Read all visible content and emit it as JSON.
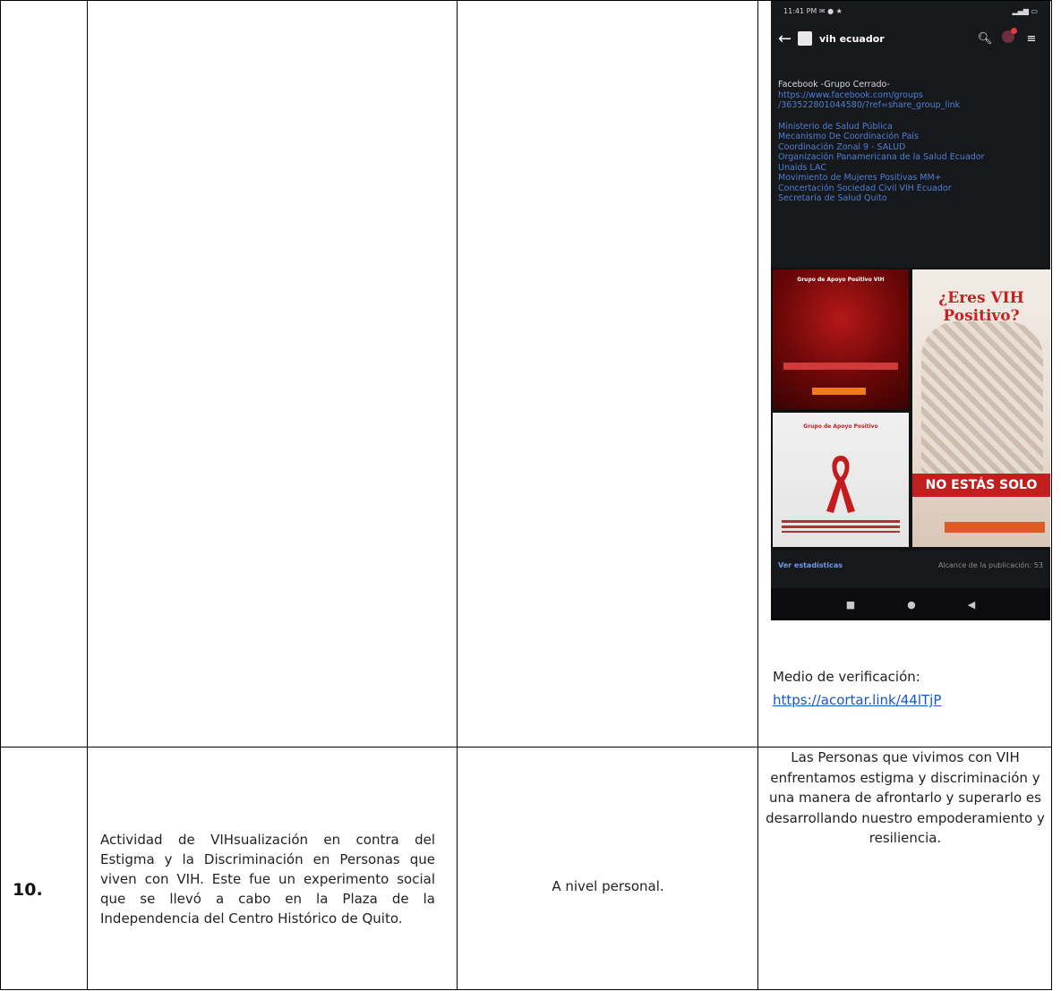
{
  "phone": {
    "status_time": "11:41 PM",
    "status_icons": "✉ ● ★",
    "status_right": "▂▄▆ ▭",
    "app_title": "vih ecuador",
    "post_heading": "Facebook -Grupo Cerrado-",
    "post_link_1": "https://www.facebook.com/groups",
    "post_link_2": "/363522801044580/?ref=share_group_link",
    "tags": [
      "Ministerio de Salud Pública",
      "Mecanismo De Coordinación País",
      "Coordinación Zonal 9 - SALUD",
      "Organización Panamericana de la Salud Ecuador",
      "Unaids LAC",
      "Movimiento de Mujeres Positivas MM+",
      "Concertación Sociedad Civil VIH Ecuador",
      "Secretaría de Salud Quito"
    ],
    "tile1_caption": "Grupo de Apoyo Positivo VIH",
    "tile2_caption": "¿Eres VIH Positivo?",
    "tile2_banner": "NO ESTÁS SOLO",
    "tile3_caption": "Grupo de Apoyo Positivo",
    "stats_link": "Ver estadísticas",
    "stats_reach": "Alcance de la publicación: 53"
  },
  "verification": {
    "label": "Medio de verificación:",
    "link": "https://acortar.link/44lTjP"
  },
  "row2": {
    "number": "10.",
    "description": "Actividad de VIHsualización en contra del Estigma y la Discriminación en Personas que viven con VIH. Este fue un experimento social que se llevó a cabo en la Plaza de la Independencia del Centro Histórico de Quito.",
    "level": "A nivel personal.",
    "result": "Las Personas que vivimos con VIH enfrentamos estigma y discriminación y una manera de afrontarlo y superarlo es desarrollando nuestro empoderamiento y resiliencia."
  }
}
